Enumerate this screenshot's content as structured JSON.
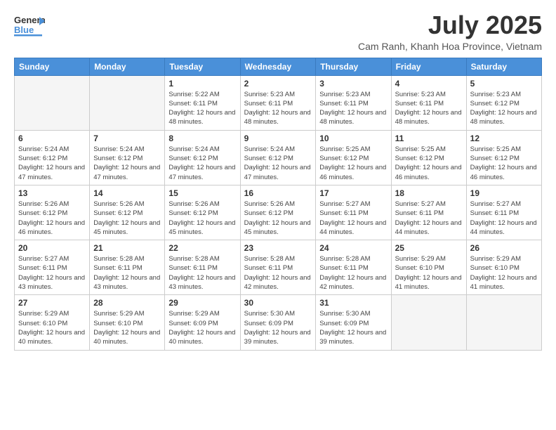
{
  "header": {
    "logo_general": "General",
    "logo_blue": "Blue",
    "month_title": "July 2025",
    "subtitle": "Cam Ranh, Khanh Hoa Province, Vietnam"
  },
  "weekdays": [
    "Sunday",
    "Monday",
    "Tuesday",
    "Wednesday",
    "Thursday",
    "Friday",
    "Saturday"
  ],
  "weeks": [
    [
      {
        "day": "",
        "info": ""
      },
      {
        "day": "",
        "info": ""
      },
      {
        "day": "1",
        "sunrise": "5:22 AM",
        "sunset": "6:11 PM",
        "daylight": "12 hours and 48 minutes."
      },
      {
        "day": "2",
        "sunrise": "5:23 AM",
        "sunset": "6:11 PM",
        "daylight": "12 hours and 48 minutes."
      },
      {
        "day": "3",
        "sunrise": "5:23 AM",
        "sunset": "6:11 PM",
        "daylight": "12 hours and 48 minutes."
      },
      {
        "day": "4",
        "sunrise": "5:23 AM",
        "sunset": "6:11 PM",
        "daylight": "12 hours and 48 minutes."
      },
      {
        "day": "5",
        "sunrise": "5:23 AM",
        "sunset": "6:12 PM",
        "daylight": "12 hours and 48 minutes."
      }
    ],
    [
      {
        "day": "6",
        "sunrise": "5:24 AM",
        "sunset": "6:12 PM",
        "daylight": "12 hours and 47 minutes."
      },
      {
        "day": "7",
        "sunrise": "5:24 AM",
        "sunset": "6:12 PM",
        "daylight": "12 hours and 47 minutes."
      },
      {
        "day": "8",
        "sunrise": "5:24 AM",
        "sunset": "6:12 PM",
        "daylight": "12 hours and 47 minutes."
      },
      {
        "day": "9",
        "sunrise": "5:24 AM",
        "sunset": "6:12 PM",
        "daylight": "12 hours and 47 minutes."
      },
      {
        "day": "10",
        "sunrise": "5:25 AM",
        "sunset": "6:12 PM",
        "daylight": "12 hours and 46 minutes."
      },
      {
        "day": "11",
        "sunrise": "5:25 AM",
        "sunset": "6:12 PM",
        "daylight": "12 hours and 46 minutes."
      },
      {
        "day": "12",
        "sunrise": "5:25 AM",
        "sunset": "6:12 PM",
        "daylight": "12 hours and 46 minutes."
      }
    ],
    [
      {
        "day": "13",
        "sunrise": "5:26 AM",
        "sunset": "6:12 PM",
        "daylight": "12 hours and 46 minutes."
      },
      {
        "day": "14",
        "sunrise": "5:26 AM",
        "sunset": "6:12 PM",
        "daylight": "12 hours and 45 minutes."
      },
      {
        "day": "15",
        "sunrise": "5:26 AM",
        "sunset": "6:12 PM",
        "daylight": "12 hours and 45 minutes."
      },
      {
        "day": "16",
        "sunrise": "5:26 AM",
        "sunset": "6:12 PM",
        "daylight": "12 hours and 45 minutes."
      },
      {
        "day": "17",
        "sunrise": "5:27 AM",
        "sunset": "6:11 PM",
        "daylight": "12 hours and 44 minutes."
      },
      {
        "day": "18",
        "sunrise": "5:27 AM",
        "sunset": "6:11 PM",
        "daylight": "12 hours and 44 minutes."
      },
      {
        "day": "19",
        "sunrise": "5:27 AM",
        "sunset": "6:11 PM",
        "daylight": "12 hours and 44 minutes."
      }
    ],
    [
      {
        "day": "20",
        "sunrise": "5:27 AM",
        "sunset": "6:11 PM",
        "daylight": "12 hours and 43 minutes."
      },
      {
        "day": "21",
        "sunrise": "5:28 AM",
        "sunset": "6:11 PM",
        "daylight": "12 hours and 43 minutes."
      },
      {
        "day": "22",
        "sunrise": "5:28 AM",
        "sunset": "6:11 PM",
        "daylight": "12 hours and 43 minutes."
      },
      {
        "day": "23",
        "sunrise": "5:28 AM",
        "sunset": "6:11 PM",
        "daylight": "12 hours and 42 minutes."
      },
      {
        "day": "24",
        "sunrise": "5:28 AM",
        "sunset": "6:11 PM",
        "daylight": "12 hours and 42 minutes."
      },
      {
        "day": "25",
        "sunrise": "5:29 AM",
        "sunset": "6:10 PM",
        "daylight": "12 hours and 41 minutes."
      },
      {
        "day": "26",
        "sunrise": "5:29 AM",
        "sunset": "6:10 PM",
        "daylight": "12 hours and 41 minutes."
      }
    ],
    [
      {
        "day": "27",
        "sunrise": "5:29 AM",
        "sunset": "6:10 PM",
        "daylight": "12 hours and 40 minutes."
      },
      {
        "day": "28",
        "sunrise": "5:29 AM",
        "sunset": "6:10 PM",
        "daylight": "12 hours and 40 minutes."
      },
      {
        "day": "29",
        "sunrise": "5:29 AM",
        "sunset": "6:09 PM",
        "daylight": "12 hours and 40 minutes."
      },
      {
        "day": "30",
        "sunrise": "5:30 AM",
        "sunset": "6:09 PM",
        "daylight": "12 hours and 39 minutes."
      },
      {
        "day": "31",
        "sunrise": "5:30 AM",
        "sunset": "6:09 PM",
        "daylight": "12 hours and 39 minutes."
      },
      {
        "day": "",
        "info": ""
      },
      {
        "day": "",
        "info": ""
      }
    ]
  ]
}
